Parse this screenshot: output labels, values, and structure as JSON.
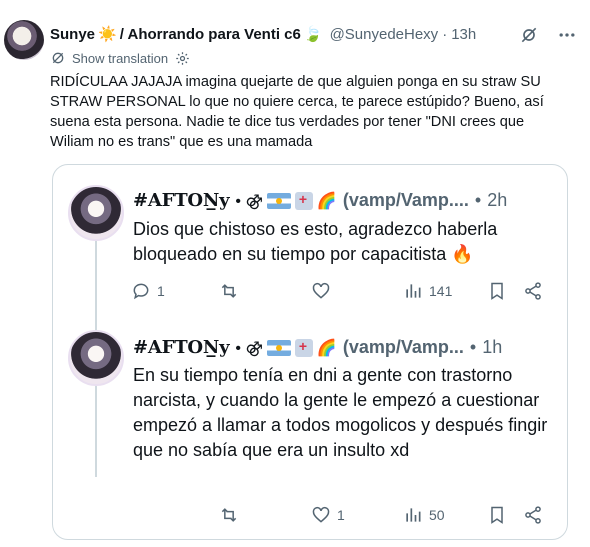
{
  "main_tweet": {
    "display_name": "Sunye",
    "name_suffix": "/ Ahorrando para Venti c6",
    "sun_emoji": "☀️",
    "leaf_emoji": "🍃",
    "handle": "@SunyedeHexy",
    "dot": "·",
    "time": "13h",
    "translate_label": "Show translation",
    "text": "RIDÍCULAA JAJAJA imagina quejarte de que alguien ponga en su straw SU STRAW PERSONAL lo que no quiere cerca, te parece estúpido? Bueno, así suena esta persona. Nadie te dice tus verdades por tener \"DNI crees que Wiliam no es trans\" que es una mamada"
  },
  "quoted_thread": {
    "tweets": [
      {
        "name": "#AFTON̲y",
        "badge_symbols": "• ⚣",
        "rainbow": "🌈",
        "handle": "(vamp/Vamp/Vamp/...)",
        "handle_display": "(vamp/Vamp....",
        "dot": "•",
        "time": "2h",
        "text": "Dios que chistoso es esto, agradezco haberla bloqueado en  su tiempo por capacitista 🔥",
        "replies": "1",
        "retweets": "",
        "likes": "",
        "views": "141"
      },
      {
        "name": "#AFTON̲y",
        "badge_symbols": "• ⚣",
        "rainbow": "🌈",
        "handle_display": "(vamp/Vamp...",
        "dot": "•",
        "time": "1h",
        "text": "En su tiempo tenía en dni a gente con trastorno narcista, y cuando la gente le empezó a cuestionar empezó a llamar a todos mogolicos y después fingir que no sabía que era un insulto xd",
        "replies": "",
        "retweets": "",
        "likes": "1",
        "views": "50"
      }
    ]
  },
  "colors": {
    "secondary_text": "#536471",
    "border": "#cfd9de",
    "primary_text": "#0f1419"
  },
  "icons": [
    "translate-icon",
    "settings-gear-icon",
    "grok-icon",
    "more-icon",
    "reply-icon",
    "retweet-icon",
    "like-icon",
    "views-icon",
    "bookmark-icon",
    "share-icon"
  ]
}
